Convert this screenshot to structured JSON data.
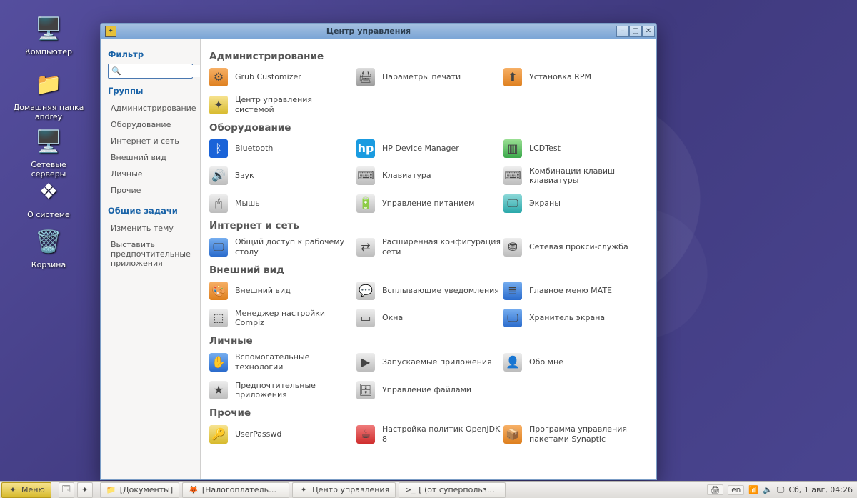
{
  "desktop_icons": [
    {
      "name": "computer",
      "label": "Компьютер",
      "glyph": "🖥️"
    },
    {
      "name": "home-folder",
      "label": "Домашняя папка andrey",
      "glyph": "📁"
    },
    {
      "name": "network-servers",
      "label": "Сетевые серверы",
      "glyph": "🖥️"
    },
    {
      "name": "about-system",
      "label": "О системе",
      "glyph": "❖"
    },
    {
      "name": "trash",
      "label": "Корзина",
      "glyph": "🗑️"
    }
  ],
  "window": {
    "title": "Центр управления"
  },
  "sidebar": {
    "filter_head": "Фильтр",
    "search_placeholder": "",
    "groups_head": "Группы",
    "groups": [
      "Администрирование",
      "Оборудование",
      "Интернет и сеть",
      "Внешний вид",
      "Личные",
      "Прочие"
    ],
    "tasks_head": "Общие задачи",
    "tasks": [
      "Изменить тему",
      "Выставить предпочтительные приложения"
    ]
  },
  "sections": [
    {
      "title": "Администрирование",
      "items": [
        {
          "label": "Grub Customizer",
          "ic": "c-orange",
          "glyph": "⚙"
        },
        {
          "label": "Параметры печати",
          "ic": "c-grey",
          "glyph": "🖨"
        },
        {
          "label": "Установка RPM",
          "ic": "c-orange",
          "glyph": "⬆"
        },
        {
          "label": "Центр управления системой",
          "ic": "c-yellow",
          "glyph": "✦"
        }
      ]
    },
    {
      "title": "Оборудование",
      "items": [
        {
          "label": "Bluetooth",
          "ic": "c-bt",
          "glyph": "ᛒ"
        },
        {
          "label": "HP Device Manager",
          "ic": "c-hp",
          "glyph": "hp"
        },
        {
          "label": "LCDTest",
          "ic": "c-green",
          "glyph": "▥"
        },
        {
          "label": "Звук",
          "ic": "c-steel",
          "glyph": "🔊"
        },
        {
          "label": "Клавиатура",
          "ic": "c-steel",
          "glyph": "⌨"
        },
        {
          "label": "Комбинации клавиш клавиатуры",
          "ic": "c-steel",
          "glyph": "⌨"
        },
        {
          "label": "Мышь",
          "ic": "c-steel",
          "glyph": "🖱"
        },
        {
          "label": "Управление питанием",
          "ic": "c-steel",
          "glyph": "🔋"
        },
        {
          "label": "Экраны",
          "ic": "c-teal",
          "glyph": "🖵"
        }
      ]
    },
    {
      "title": "Интернет и сеть",
      "items": [
        {
          "label": "Общий доступ к рабочему столу",
          "ic": "c-blue",
          "glyph": "🖵"
        },
        {
          "label": "Расширенная конфигурация сети",
          "ic": "c-steel",
          "glyph": "⇄"
        },
        {
          "label": "Сетевая прокси-служба",
          "ic": "c-steel",
          "glyph": "⛃"
        }
      ]
    },
    {
      "title": "Внешний вид",
      "items": [
        {
          "label": "Внешний вид",
          "ic": "c-orange",
          "glyph": "🎨"
        },
        {
          "label": "Всплывающие уведомления",
          "ic": "c-steel",
          "glyph": "💬"
        },
        {
          "label": "Главное меню MATE",
          "ic": "c-blue",
          "glyph": "≣"
        },
        {
          "label": "Менеджер настройки Compiz",
          "ic": "c-steel",
          "glyph": "⬚"
        },
        {
          "label": "Окна",
          "ic": "c-steel",
          "glyph": "▭"
        },
        {
          "label": "Хранитель экрана",
          "ic": "c-blue",
          "glyph": "🖵"
        }
      ]
    },
    {
      "title": "Личные",
      "items": [
        {
          "label": "Вспомогательные технологии",
          "ic": "c-blue",
          "glyph": "✋"
        },
        {
          "label": "Запускаемые приложения",
          "ic": "c-steel",
          "glyph": "▶"
        },
        {
          "label": "Обо мне",
          "ic": "c-steel",
          "glyph": "👤"
        },
        {
          "label": "Предпочтительные приложения",
          "ic": "c-steel",
          "glyph": "★"
        },
        {
          "label": "Управление файлами",
          "ic": "c-steel",
          "glyph": "🗄"
        }
      ]
    },
    {
      "title": "Прочие",
      "items": [
        {
          "label": "UserPasswd",
          "ic": "c-yellow",
          "glyph": "🔑"
        },
        {
          "label": "Настройка политик OpenJDK 8",
          "ic": "c-red",
          "glyph": "☕"
        },
        {
          "label": "Программа управления пакетами Synaptic",
          "ic": "c-orange",
          "glyph": "📦"
        }
      ]
    }
  ],
  "taskbar": {
    "menu": "Меню",
    "items": [
      {
        "label": "[Документы]",
        "glyph": "📁"
      },
      {
        "label": "[Налогоплательщик ЮЛ | …",
        "glyph": "🦊"
      },
      {
        "label": "Центр управления",
        "glyph": "✦"
      },
      {
        "label": "[ (от суперпользователя)]",
        "glyph": ">_"
      }
    ],
    "lang": "en",
    "clock": "Сб, 1 авг, 04:26"
  }
}
